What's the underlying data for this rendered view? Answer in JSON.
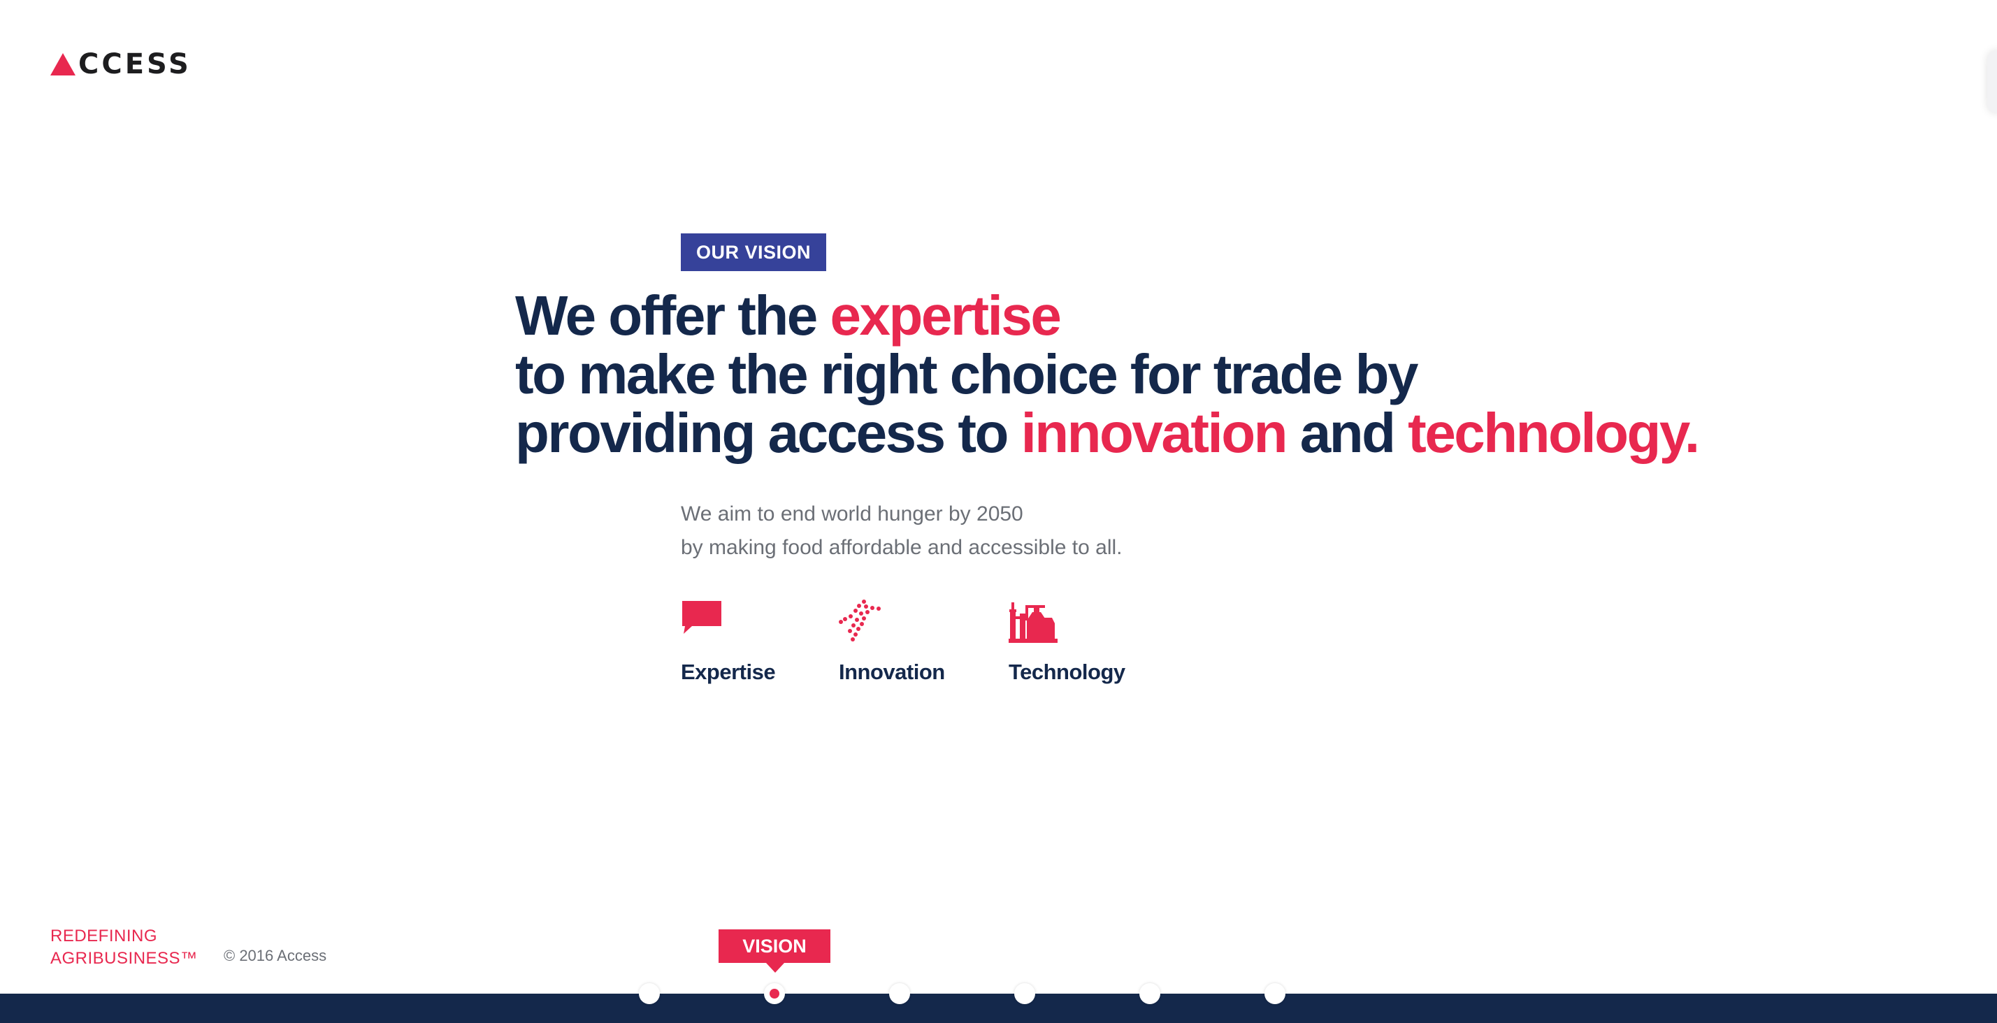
{
  "brand": {
    "logo_text": "CCESS",
    "logo_icon": "triangle-a-logo-icon",
    "primary_color": "#e8284f",
    "navy_color": "#14284b",
    "tag_color": "#36429a"
  },
  "section": {
    "tag": "OUR VISION"
  },
  "headline": {
    "line1_a": "We offer the ",
    "line1_b": "expertise",
    "line2": "to make the right choice for trade by",
    "line3_a": "providing access to ",
    "line3_b": "innovation",
    "line3_c": " and ",
    "line3_d": "technology."
  },
  "subcopy": {
    "line1": "We aim to end world hunger by 2050",
    "line2": "by making food affordable and accessible to all."
  },
  "features": [
    {
      "label": "Expertise",
      "icon": "speech-bubble-icon"
    },
    {
      "label": "Innovation",
      "icon": "dna-helix-icon"
    },
    {
      "label": "Technology",
      "icon": "factory-icon"
    }
  ],
  "footer": {
    "tagline_line1": "REDEFINING",
    "tagline_line2": "AGRIBUSINESS™",
    "copyright": "© 2016 Access"
  },
  "nav": {
    "current_label": "VISION",
    "total_steps": 6,
    "active_step": 2
  }
}
